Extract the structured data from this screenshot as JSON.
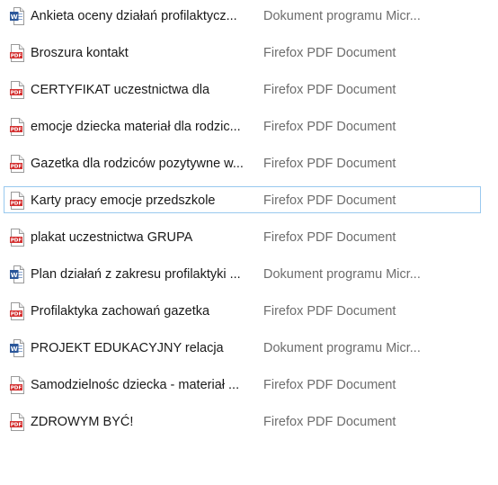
{
  "files": [
    {
      "name": "Ankieta oceny działań profilaktycz...",
      "type": "Dokument programu Micr...",
      "icon": "word-document-icon"
    },
    {
      "name": "Broszura kontakt",
      "type": "Firefox PDF Document",
      "icon": "pdf-document-icon"
    },
    {
      "name": "CERTYFIKAT uczestnictwa dla",
      "type": "Firefox PDF Document",
      "icon": "pdf-document-icon"
    },
    {
      "name": "emocje dziecka materiał dla rodzic...",
      "type": "Firefox PDF Document",
      "icon": "pdf-document-icon"
    },
    {
      "name": "Gazetka dla rodziców pozytywne w...",
      "type": "Firefox PDF Document",
      "icon": "pdf-document-icon"
    },
    {
      "name": "Karty pracy emocje przedszkole",
      "type": "Firefox PDF Document",
      "icon": "pdf-document-icon"
    },
    {
      "name": "plakat uczestnictwa GRUPA",
      "type": "Firefox PDF Document",
      "icon": "pdf-document-icon"
    },
    {
      "name": "Plan działań z zakresu profilaktyki ...",
      "type": "Dokument programu Micr...",
      "icon": "word-document-icon"
    },
    {
      "name": "Profilaktyka zachowań gazetka",
      "type": "Firefox PDF Document",
      "icon": "pdf-document-icon"
    },
    {
      "name": "PROJEKT EDUKACYJNY relacja",
      "type": "Dokument programu Micr...",
      "icon": "word-document-icon"
    },
    {
      "name": "Samodzielnośc dziecka - materiał ...",
      "type": "Firefox PDF Document",
      "icon": "pdf-document-icon"
    },
    {
      "name": "ZDROWYM BYĆ!",
      "type": "Firefox PDF Document",
      "icon": "pdf-document-icon"
    }
  ],
  "hovered_row": 5,
  "colors": {
    "pdf_icon": "#d32f2f",
    "word_icon": "#2b579a",
    "hover_border": "#99c9ef"
  }
}
